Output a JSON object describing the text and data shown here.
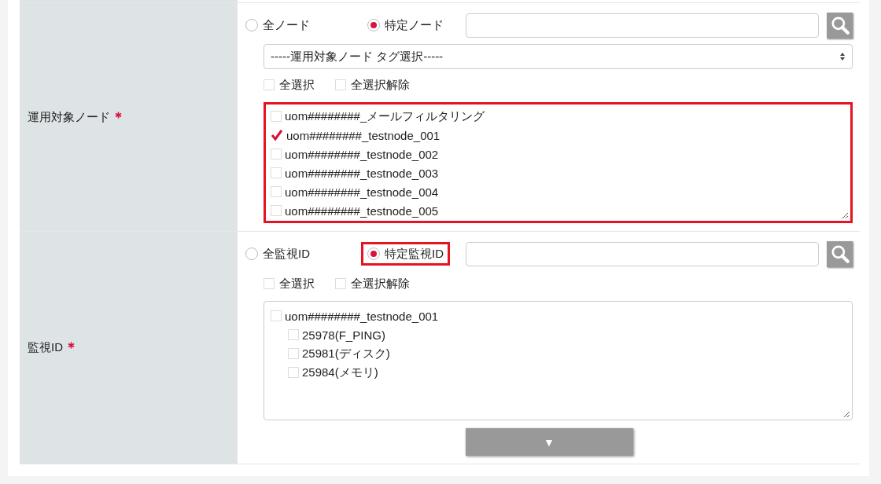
{
  "rows": [
    {
      "label": "運用対象ノード",
      "required": true,
      "scope_options": [
        {
          "label": "全ノード",
          "selected": false,
          "highlighted": false
        },
        {
          "label": "特定ノード",
          "selected": true,
          "highlighted": false
        }
      ],
      "tag_select": {
        "value": "-----運用対象ノード タグ選択-----"
      },
      "select_all": {
        "label": "全選択",
        "checked": false
      },
      "deselect_all": {
        "label": "全選択解除",
        "checked": false
      },
      "list": {
        "highlighted": true,
        "items": [
          {
            "label": "uom########_メールフィルタリング",
            "checked": false
          },
          {
            "label": "uom########_testnode_001",
            "checked": true
          },
          {
            "label": "uom########_testnode_002",
            "checked": false
          },
          {
            "label": "uom########_testnode_003",
            "checked": false
          },
          {
            "label": "uom########_testnode_004",
            "checked": false
          },
          {
            "label": "uom########_testnode_005",
            "checked": false
          }
        ]
      }
    },
    {
      "label": "監視ID",
      "required": true,
      "scope_options": [
        {
          "label": "全監視ID",
          "selected": false,
          "highlighted": false
        },
        {
          "label": "特定監視ID",
          "selected": true,
          "highlighted": true
        }
      ],
      "select_all": {
        "label": "全選択",
        "checked": false
      },
      "deselect_all": {
        "label": "全選択解除",
        "checked": false
      },
      "list": {
        "highlighted": false,
        "items": [
          {
            "label": "uom########_testnode_001",
            "checked": false,
            "children": [
              {
                "label": "25978(F_PING)",
                "checked": false
              },
              {
                "label": "25981(ディスク)",
                "checked": false
              },
              {
                "label": "25984(メモリ)",
                "checked": false
              }
            ]
          }
        ]
      },
      "expand_button": {
        "label": "▼"
      }
    }
  ]
}
